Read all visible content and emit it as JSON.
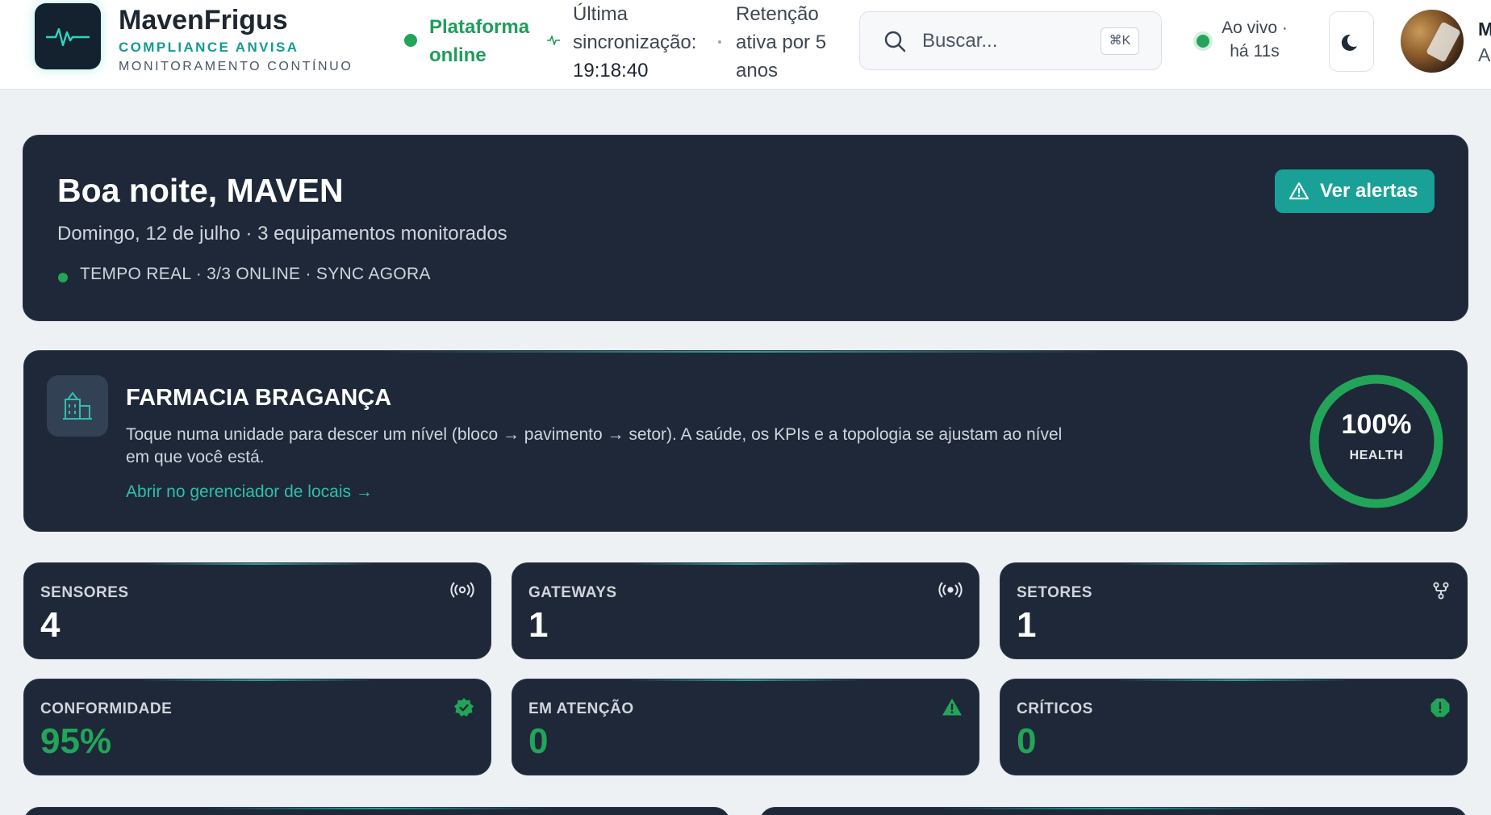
{
  "header": {
    "brand_name": "MavenFrigus",
    "brand_sub": "COMPLIANCE ANVISA",
    "brand_sub2": "MONITORAMENTO CONTÍNUO",
    "status_line1": "Plataforma",
    "status_line2": "online",
    "sync_line1": "Última",
    "sync_line2": "sincronização:",
    "sync_time": "19:18:40",
    "retention_line1": "Retenção",
    "retention_line2": "ativa por 5",
    "retention_line3": "anos",
    "search_placeholder": "Buscar...",
    "search_shortcut": "⌘K",
    "live_line1": "Ao vivo ·",
    "live_line2": "há 11s",
    "user_initial": "M",
    "user_sub_initial": "A"
  },
  "greeting": {
    "title": "Boa noite, MAVEN",
    "subtitle": "Domingo, 12 de julho · 3 equipamentos monitorados",
    "status": "TEMPO REAL · 3/3 ONLINE  · SYNC AGORA",
    "alert_button": "Ver alertas"
  },
  "location": {
    "title": "FARMACIA BRAGANÇA",
    "description": "Toque numa unidade para descer um nível (bloco → pavimento → setor). A saúde, os KPIs e a topologia se ajustam ao nível em que você está.",
    "link": "Abrir no gerenciador de locais →",
    "health_value": "100%",
    "health_label": "HEALTH",
    "health_fraction": 1.0
  },
  "kpis": [
    {
      "label": "SENSORES",
      "value": "4",
      "icon": "broadcast-icon"
    },
    {
      "label": "GATEWAYS",
      "value": "1",
      "icon": "broadcast-filled-icon"
    },
    {
      "label": "SETORES",
      "value": "1",
      "icon": "branch-icon"
    },
    {
      "label": "CONFORMIDADE",
      "value": "95%",
      "icon": "verified-badge-icon"
    },
    {
      "label": "EM ATENÇÃO",
      "value": "0",
      "icon": "warning-triangle-icon"
    },
    {
      "label": "CRÍTICOS",
      "value": "0",
      "icon": "alert-octagon-icon"
    }
  ],
  "colors": {
    "accent": "#1aa197",
    "success": "#22a559",
    "card_bg": "#1e2838",
    "page_bg": "#eef1f4"
  }
}
